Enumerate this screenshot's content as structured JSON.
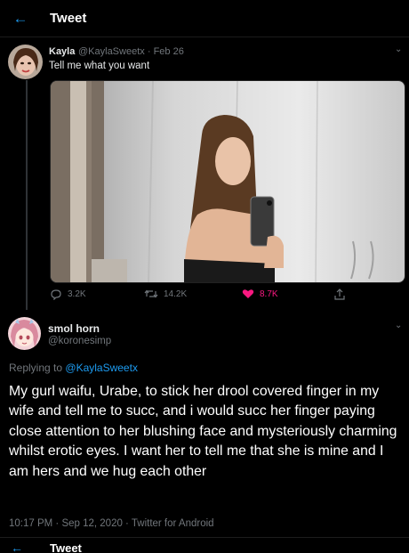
{
  "header": {
    "back_icon": "arrow-left-icon",
    "title": "Tweet"
  },
  "tweet": {
    "author_name": "Kayla",
    "author_handle": "@KaylaSweetx",
    "date": "Feb 26",
    "text": "Tell me what you want",
    "media_description": "photo",
    "stats": {
      "replies": "3.2K",
      "retweets": "14.2K",
      "likes": "8.7K"
    },
    "like_color": "#f91880"
  },
  "reply": {
    "author_name": "smol horn",
    "author_handle": "@koronesimp",
    "replying_to_prefix": "Replying to",
    "replying_to_handle": "@KaylaSweetx",
    "text": "My gurl waifu, Urabe, to stick her drool covered finger in my wife and tell me to succ, and i would succ her finger paying close attention to her blushing face and mysteriously charming whilst erotic eyes. I want her to tell me that she is mine and I am hers and we hug each other",
    "timestamp": "10:17 PM · Sep 12, 2020 · Twitter for Android"
  },
  "footer": {
    "title": "Tweet"
  },
  "colors": {
    "accent": "#1d9bf0",
    "muted": "#71767b",
    "background": "#000000"
  }
}
